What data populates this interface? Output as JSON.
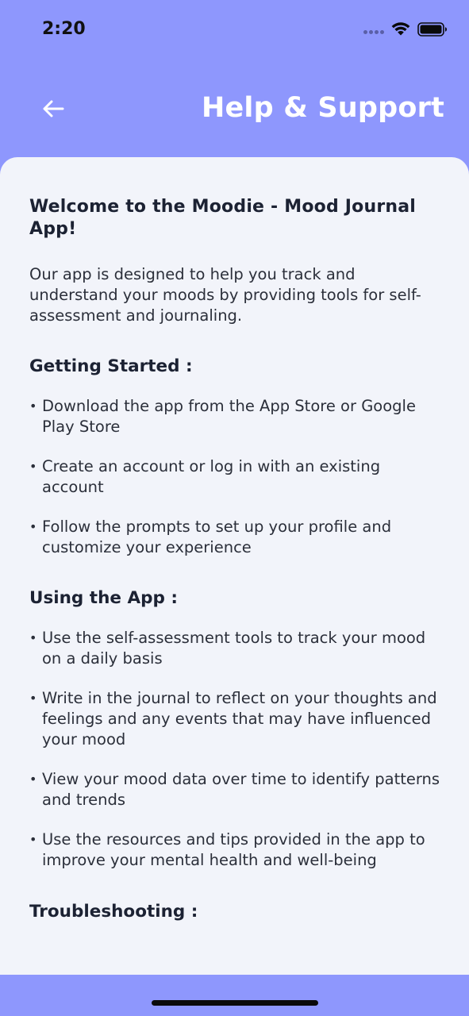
{
  "status_bar": {
    "time": "2:20"
  },
  "header": {
    "title": "Help & Support",
    "back_icon": "arrow-left-icon"
  },
  "content": {
    "welcome": "Welcome to the Moodie - Mood Journal App!",
    "intro": "Our app is designed to help you track and understand your moods by providing tools for self-assessment and journaling.",
    "sections": [
      {
        "heading": "Getting Started :",
        "items": [
          "Download the app from the App Store or Google Play Store",
          "Create an account or log in with an existing account",
          "Follow the prompts to set up your profile and customize your experience"
        ]
      },
      {
        "heading": "Using the App :",
        "items": [
          "Use the self-assessment tools to track your mood on a daily basis",
          "Write in the journal to reflect on your thoughts and feelings and any events that may have influenced your mood",
          "View your mood data over time to identify patterns and trends",
          "Use the resources and tips provided in the app to improve your mental health and well-being"
        ]
      },
      {
        "heading": "Troubleshooting :",
        "items": []
      }
    ],
    "bullet": "•"
  },
  "colors": {
    "brand": "#8e97fd",
    "card_background": "#f2f4fa",
    "text": "#1c2233",
    "title": "#ffffff"
  }
}
